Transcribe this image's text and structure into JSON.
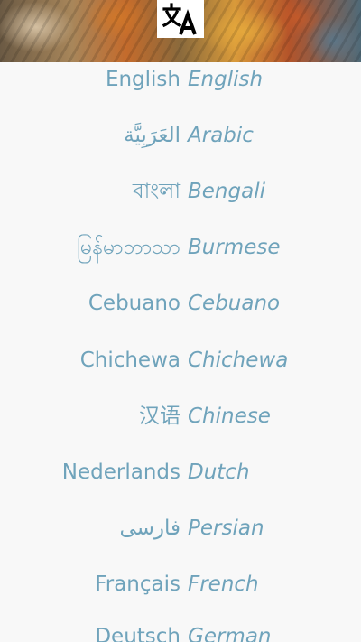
{
  "header": {
    "logo_icon": "translate-icon",
    "banner": "comic-art-banner"
  },
  "languages": [
    {
      "native": "English",
      "english": "English"
    },
    {
      "native": "العَرَبِيَّة",
      "english": "Arabic"
    },
    {
      "native": "বাংলা",
      "english": "Bengali"
    },
    {
      "native": "မြန်မာဘာသာ",
      "english": "Burmese"
    },
    {
      "native": "Cebuano",
      "english": "Cebuano"
    },
    {
      "native": "Chichewa",
      "english": "Chichewa"
    },
    {
      "native": "汉语",
      "english": "Chinese"
    },
    {
      "native": "Nederlands",
      "english": "Dutch"
    },
    {
      "native": "فارسی",
      "english": "Persian"
    },
    {
      "native": "Français",
      "english": "French"
    },
    {
      "native": "Deutsch",
      "english": "German"
    }
  ],
  "colors": {
    "text": "#6fa3bb",
    "background": "#f8f8f8"
  }
}
